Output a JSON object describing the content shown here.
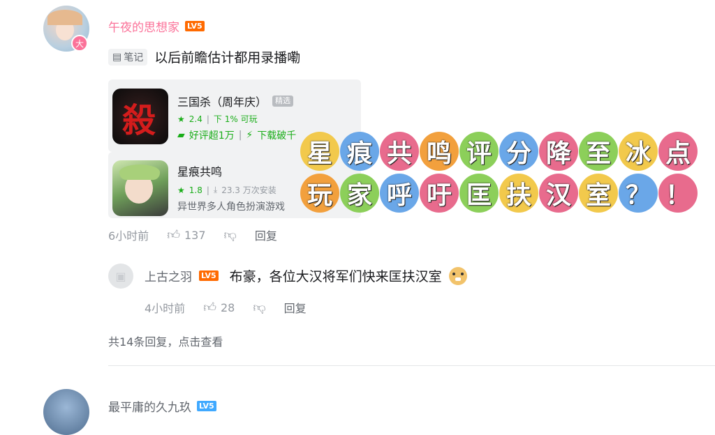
{
  "comment": {
    "username": "午夜的思想家",
    "level": "LV5",
    "note_label": "笔记",
    "text": "以后前瞻估计都用录播嘞",
    "time": "6小时前",
    "likes": "137",
    "reply_label": "回复",
    "view_replies": "共14条回复，点击查看"
  },
  "apps": [
    {
      "name": "三国杀（周年庆）",
      "tag": "精选",
      "rating": "2.4",
      "downloads": "下 1% 可玩",
      "highlight1": "好评超1万",
      "highlight2": "下载破千"
    },
    {
      "name": "星痕共鸣",
      "rating": "1.8",
      "downloads": "23.3 万次安装",
      "desc": "异世界多人角色扮演游戏"
    }
  ],
  "reply": {
    "username": "上古之羽",
    "level": "LV5",
    "text": "布豪，各位大汉将军们快来匡扶汉室",
    "time": "4小时前",
    "likes": "28",
    "reply_label": "回复"
  },
  "next_comment": {
    "username": "最平庸的久九玖",
    "level": "LV5"
  },
  "overlay": {
    "line1": [
      "星",
      "痕",
      "共",
      "鸣",
      "评",
      "分",
      "降",
      "至",
      "冰",
      "点"
    ],
    "line2": [
      "玩",
      "家",
      "呼",
      "吁",
      "匡",
      "扶",
      "汉",
      "室",
      "？",
      "！"
    ],
    "colors": [
      "#f2c94c",
      "#6aa7e8",
      "#e86b8d",
      "#f2a03d",
      "#8ccf5a",
      "#6aa7e8",
      "#e86b8d",
      "#8ccf5a",
      "#f2c94c",
      "#e86b8d"
    ]
  },
  "colors": {
    "username_pink": "#fb7299",
    "level_orange": "#ff6a00",
    "level_blue": "#40a9ff",
    "green": "#1aad19"
  }
}
